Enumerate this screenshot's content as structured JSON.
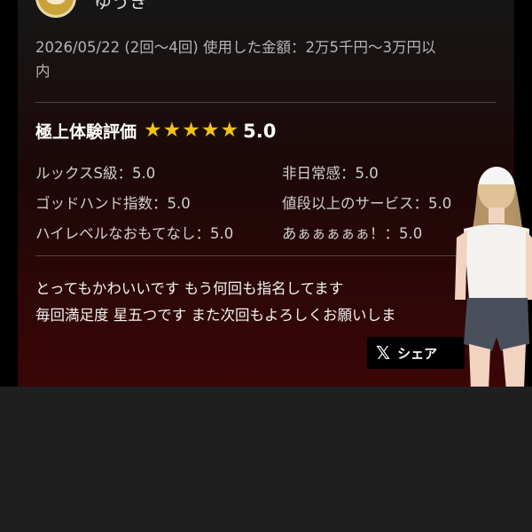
{
  "review": {
    "reviewer_name": "ゆうき",
    "date": "2026/05/22",
    "visits": "(2回〜4回)",
    "amount_label": "使用した金額：",
    "amount_line1": "2万5千円〜3万円以",
    "amount_line2": "内",
    "rating": {
      "title": "極上体験評価",
      "stars": 5,
      "score": "5.0"
    },
    "sub_ratings": [
      {
        "label": "ルックスS級：",
        "value": "5.0"
      },
      {
        "label": "非日常感：",
        "value": "5.0"
      },
      {
        "label": "ゴッドハンド指数：",
        "value": "5.0"
      },
      {
        "label": "値段以上のサービス：",
        "value": "5.0"
      },
      {
        "label": "ハイレベルなおもてなし：",
        "value": "5.0"
      },
      {
        "label": "あぁぁぁぁぁ！：",
        "value": "5.0"
      }
    ],
    "comment_line1": "とってもかわいいです もう何回も指名してます",
    "comment_line2": "毎回満足度 星五つです また次回もよろしくお願いしま",
    "share": {
      "icon": "x-logo-icon",
      "label": "シェア"
    }
  },
  "colors": {
    "star": "#f0c21a",
    "accent_dark_red": "#3a0606",
    "background": "#1c1c1c"
  }
}
